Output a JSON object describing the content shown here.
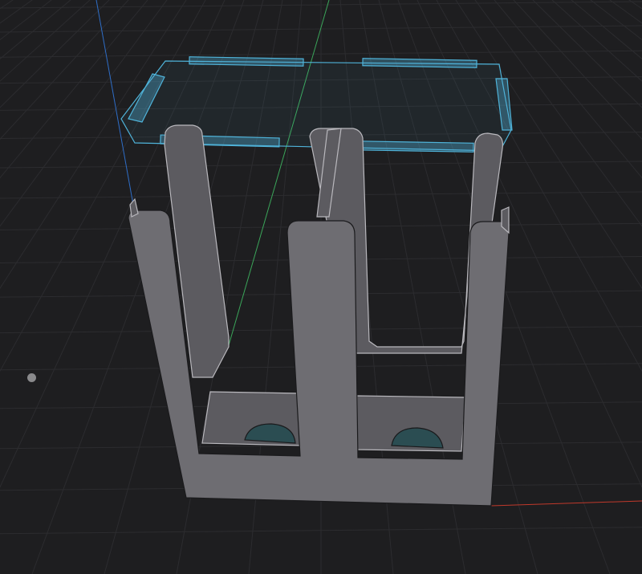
{
  "viewport": {
    "background": "#1e1e20",
    "grid_visible": true,
    "grid_color": "#2c2c2f"
  },
  "axes": {
    "x_axis_color": "#c0392b",
    "y_axis_color": "#3ba65a",
    "z_axis_color": "#2f6ec7"
  },
  "model": {
    "part": "sheet-metal-holder",
    "face_color": "#6e6d72",
    "inner_face_color": "#5c5b60",
    "edge_color": "#1a1a1c",
    "highlight_edge_color": "#b9b8bd",
    "hole_color": "#2b4d52"
  },
  "selection": {
    "type": "sketch-profile",
    "color": "#4fb3d9"
  },
  "pivot_icon": "orbit-pivot-icon"
}
